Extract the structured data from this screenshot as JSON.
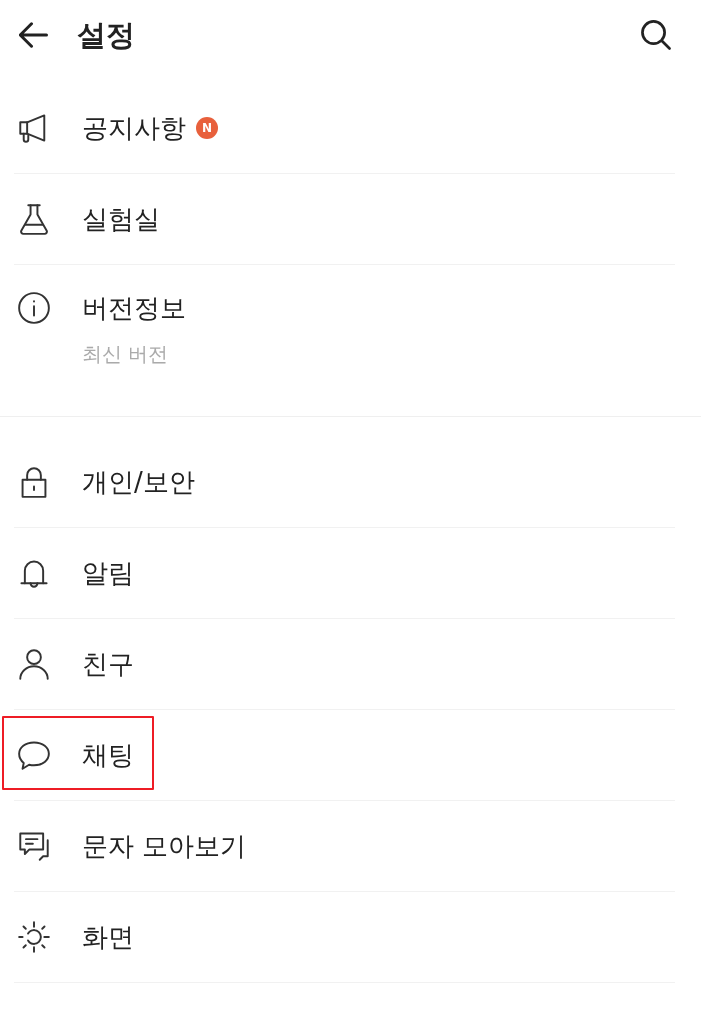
{
  "header": {
    "title": "설정"
  },
  "sections": [
    {
      "items": [
        {
          "label": "공지사항",
          "badge": "N",
          "highlighted": false
        },
        {
          "label": "실험실",
          "highlighted": false
        },
        {
          "label": "버전정보",
          "subtitle": "최신 버전",
          "highlighted": false
        }
      ]
    },
    {
      "items": [
        {
          "label": "개인/보안",
          "highlighted": false
        },
        {
          "label": "알림",
          "highlighted": false
        },
        {
          "label": "친구",
          "highlighted": false
        },
        {
          "label": "채팅",
          "highlighted": true
        },
        {
          "label": "문자 모아보기",
          "highlighted": false
        },
        {
          "label": "화면",
          "highlighted": false
        }
      ]
    }
  ]
}
